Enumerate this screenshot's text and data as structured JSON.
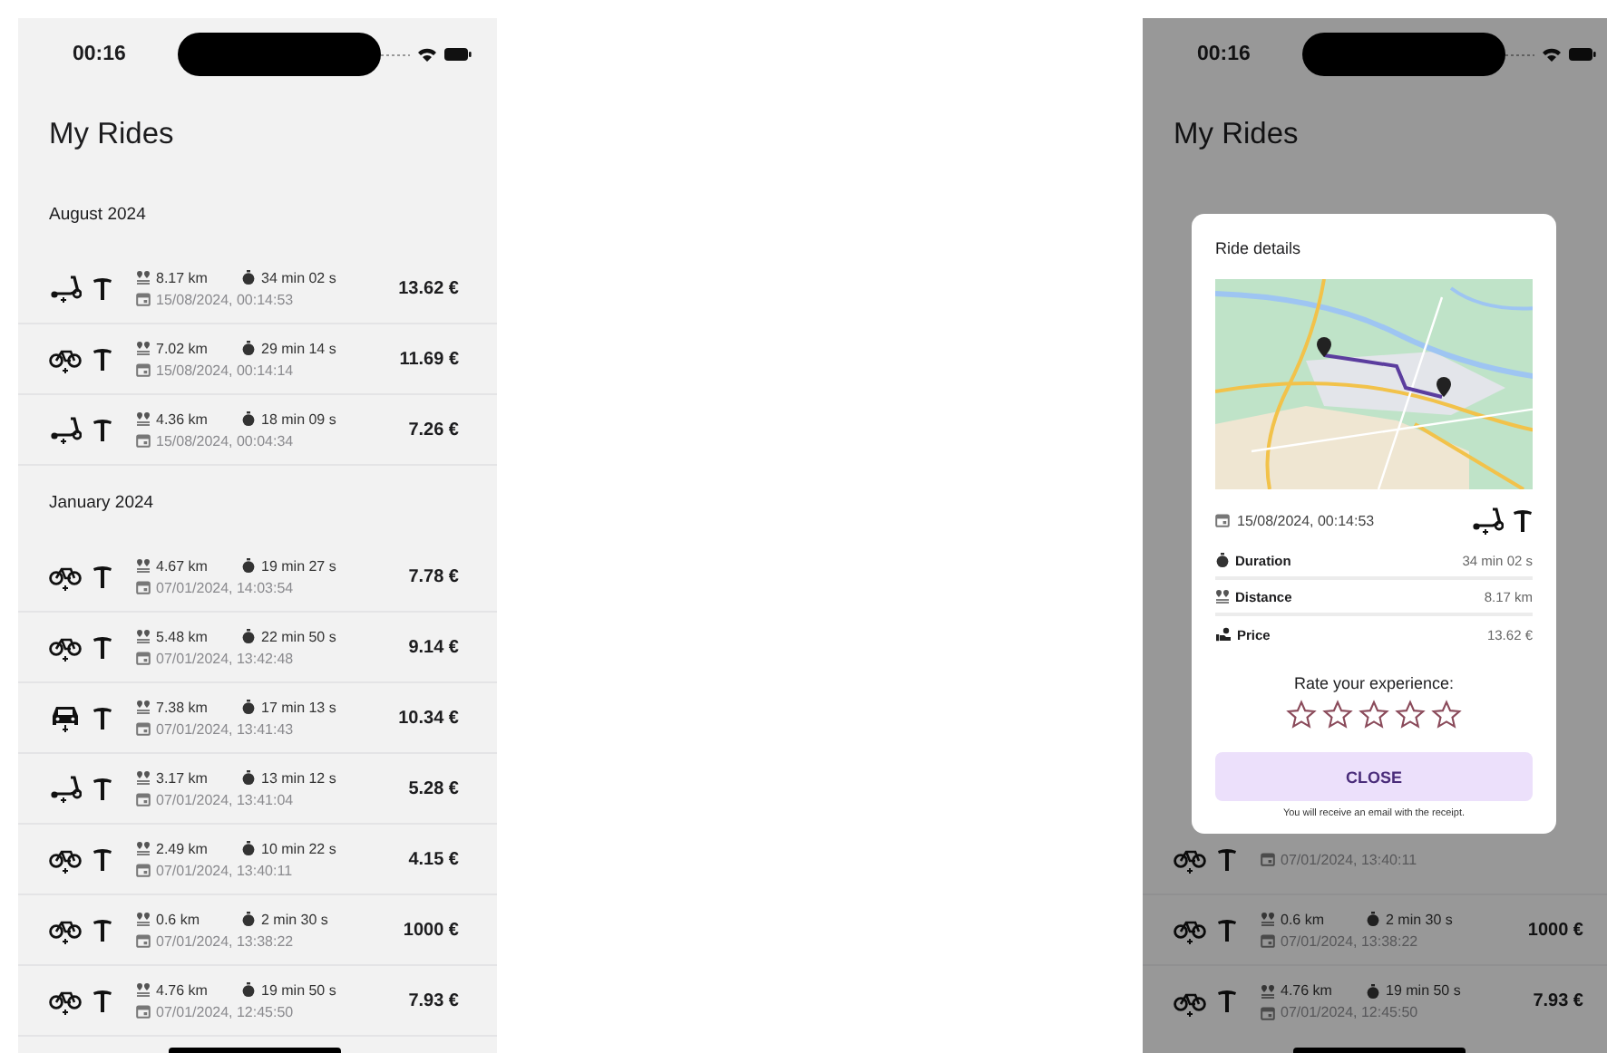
{
  "screens": [
    {
      "dimmed": false,
      "status_bar": {
        "time": "00:16"
      },
      "title": "My Rides",
      "sections": [
        {
          "label": "August 2024",
          "rides": [
            {
              "kind": "scooter",
              "distance": "8.17 km",
              "duration": "34 min 02 s",
              "date": "15/08/2024, 00:14:53",
              "price": "13.62 €"
            },
            {
              "kind": "bike",
              "distance": "7.02 km",
              "duration": "29 min 14 s",
              "date": "15/08/2024, 00:14:14",
              "price": "11.69 €"
            },
            {
              "kind": "scooter",
              "distance": "4.36 km",
              "duration": "18 min 09 s",
              "date": "15/08/2024, 00:04:34",
              "price": "7.26 €"
            }
          ]
        },
        {
          "label": "January 2024",
          "rides": [
            {
              "kind": "bike",
              "distance": "4.67 km",
              "duration": "19 min 27 s",
              "date": "07/01/2024, 14:03:54",
              "price": "7.78 €"
            },
            {
              "kind": "bike",
              "distance": "5.48 km",
              "duration": "22 min 50 s",
              "date": "07/01/2024, 13:42:48",
              "price": "9.14 €"
            },
            {
              "kind": "car",
              "distance": "7.38 km",
              "duration": "17 min 13 s",
              "date": "07/01/2024, 13:41:43",
              "price": "10.34 €"
            },
            {
              "kind": "scooter",
              "distance": "3.17 km",
              "duration": "13 min 12 s",
              "date": "07/01/2024, 13:41:04",
              "price": "5.28 €"
            },
            {
              "kind": "bike",
              "distance": "2.49 km",
              "duration": "10 min 22 s",
              "date": "07/01/2024, 13:40:11",
              "price": "4.15 €"
            },
            {
              "kind": "bike",
              "distance": "0.6 km",
              "duration": "2 min 30 s",
              "date": "07/01/2024, 13:38:22",
              "price": "1000 €"
            },
            {
              "kind": "bike",
              "distance": "4.76 km",
              "duration": "19 min 50 s",
              "date": "07/01/2024, 12:45:50",
              "price": "7.93 €"
            }
          ]
        }
      ]
    },
    {
      "dimmed": true,
      "status_bar": {
        "time": "00:16"
      },
      "title": "My Rides",
      "rides_below": [
        {
          "kind": "bike",
          "date": "07/01/2024, 13:40:11"
        },
        {
          "kind": "bike",
          "distance": "0.6 km",
          "duration": "2 min 30 s",
          "date": "07/01/2024, 13:38:22",
          "price": "1000 €"
        },
        {
          "kind": "bike",
          "distance": "4.76 km",
          "duration": "19 min 50 s",
          "date": "07/01/2024, 12:45:50",
          "price": "7.93 €"
        }
      ],
      "dialog": {
        "title": "Ride details",
        "date": "15/08/2024, 00:14:53",
        "kind": "scooter",
        "details": [
          {
            "kind": "duration",
            "label": "Duration",
            "value": "34 min 02 s"
          },
          {
            "kind": "distance",
            "label": "Distance",
            "value": "8.17 km"
          },
          {
            "kind": "price",
            "label": "Price",
            "value": "13.62 €"
          }
        ],
        "rating_prompt": "Rate your experience:",
        "stars": 0,
        "button": "CLOSE",
        "note": "You will receive an email with the receipt."
      }
    }
  ]
}
